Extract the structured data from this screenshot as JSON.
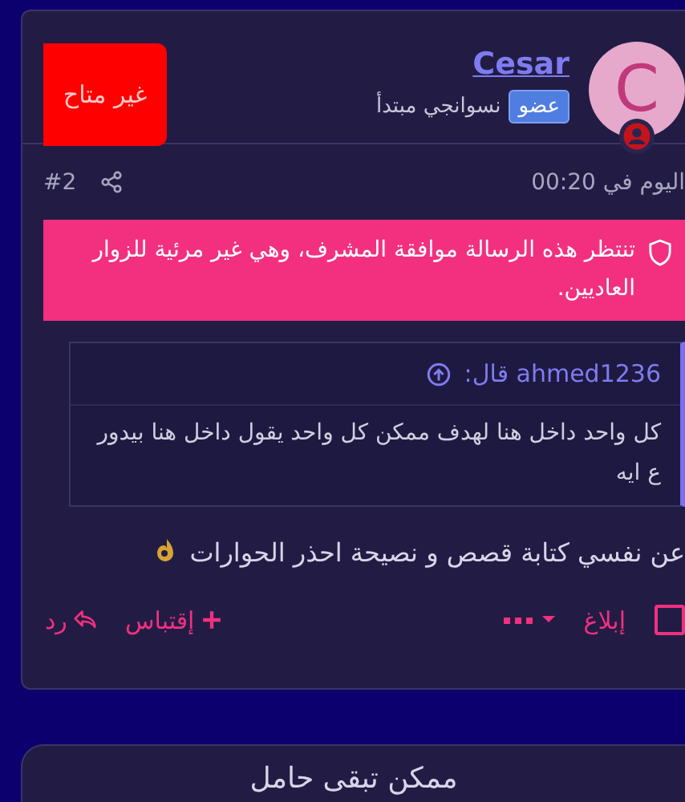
{
  "post": {
    "status_badge": "غير متاح",
    "author": {
      "initial": "C",
      "name": "Cesar",
      "rank": "نسوانجي مبتدأ",
      "role": "عضو"
    },
    "time": "اليوم في 00:20",
    "number": "#2",
    "moderation_notice": "تنتظر هذه الرسالة موافقة المشرف، وهي غير مرئية للزوار العاديين.",
    "quote": {
      "header": "ahmed1236 قال:",
      "text": "كل واحد داخل هنا لهدف ممكن كل واحد يقول داخل هنا بيدور ع ايه"
    },
    "message": "عن نفسي كتابة قصص و نصيحة احذر الحوارات",
    "actions": [
      {
        "kind": "select",
        "checked": false
      },
      {
        "kind": "report",
        "label": "إبلاغ"
      },
      {
        "kind": "more"
      },
      {
        "kind": "quote",
        "label": "إقتباس"
      },
      {
        "kind": "reply",
        "label": "رد"
      }
    ]
  },
  "next_post": {
    "text": "ممكن تبقى حامل"
  }
}
